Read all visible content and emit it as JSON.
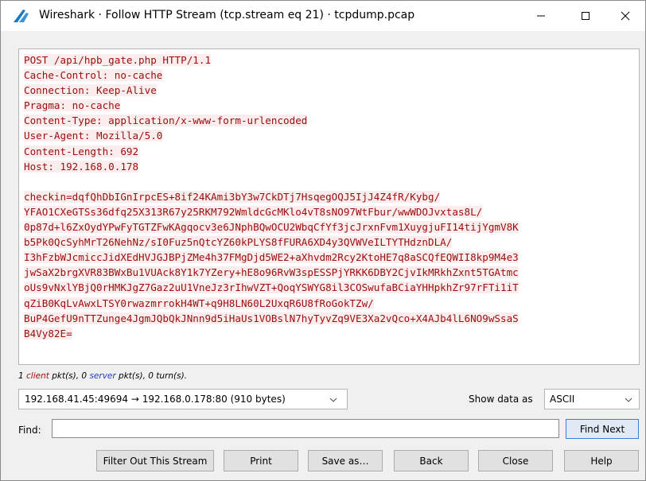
{
  "window": {
    "title": "Wireshark · Follow HTTP Stream (tcp.stream eq 21) · tcpdump.pcap",
    "controls": {
      "minimize": "—",
      "maximize": "☐",
      "close": "✕"
    }
  },
  "stream": {
    "text_color": "#9b0d0d",
    "highlight_color": "#fbeded",
    "lines": [
      "POST /api/hpb_gate.php HTTP/1.1",
      "Cache-Control: no-cache",
      "Connection: Keep-Alive",
      "Pragma: no-cache",
      "Content-Type: application/x-www-form-urlencoded",
      "User-Agent: Mozilla/5.0",
      "Content-Length: 692",
      "Host: 192.168.0.178",
      "",
      "checkin=dqfQhDbIGnIrpcES+8if24KAmi3bY3w7CkDTj7HsqegOQJ5IjJ4Z4fR/Kybg/",
      "YFAO1CXeGTSs36dfq25X313R67y25RKM792WmldcGcMKlo4vT8sNO97WtFbur/wwWDOJvxtas8L/",
      "0p87d+l6ZxOydYPwFyTGTZFwKAgqocv3e6JNphBQwOCU2WbqCfYf3jcJrxnFvm1XuygjuFI14tijYgmV8K",
      "b5Pk0QcSyhMrT26NehNz/sI0Fuz5nQtcYZ60kPLYS8fFURA6XD4y3QVWVeILTYTHdznDLA/",
      "I3hFzbWJcmiccJidXEdHVJGJBPjZMe4h37FMgDjd5WE2+aXhvdm2Rcy2KtoHE7q8aSCQfEQWII8kp9M4e3",
      "jwSaX2brgXVR83BWxBu1VUAck8Y1k7YZery+hE8o96RvW3spESSPjYRKK6DBY2CjvIkMRkhZxnt5TGAtmc",
      "oUs9vNxlYBjQ0rHMKJgZ7Gaz2uU1VneJz3rIhwVZT+QoqYSWYG8il3COSwufaBCiaYHHpkhZr97rFTi1iT",
      "qZiB0KqLvAwxLTSY0rwazmrrokH4WT+q9H8LN60L2UxqR6U8fRoGokTZw/",
      "BuP4GefU9nTTZunge4JgmJQbQkJNnn9d5iHaUs1VOBslN7hyTyvZq9VE3Xa2vQco+X4AJb4lL6NO9wSsaS",
      "B4Vy82E="
    ]
  },
  "summary": {
    "client_count": "1",
    "client_label": "client",
    "client_suffix": " pkt(s), ",
    "server_count": "0",
    "server_label": "server",
    "server_suffix": " pkt(s), 0 turn(s).",
    "client_color": "#9b0d0d",
    "server_color": "#1e3cc8"
  },
  "conversation": {
    "selected": "192.168.41.45:49694 → 192.168.0.178:80 (910 bytes)"
  },
  "show_data": {
    "label": "Show data as",
    "selected": "ASCII"
  },
  "find": {
    "label": "Find:",
    "value": "",
    "button": "Find Next"
  },
  "buttons": {
    "filter_out": "Filter Out This Stream",
    "print": "Print",
    "save_as": "Save as…",
    "back": "Back",
    "close": "Close",
    "help": "Help"
  }
}
